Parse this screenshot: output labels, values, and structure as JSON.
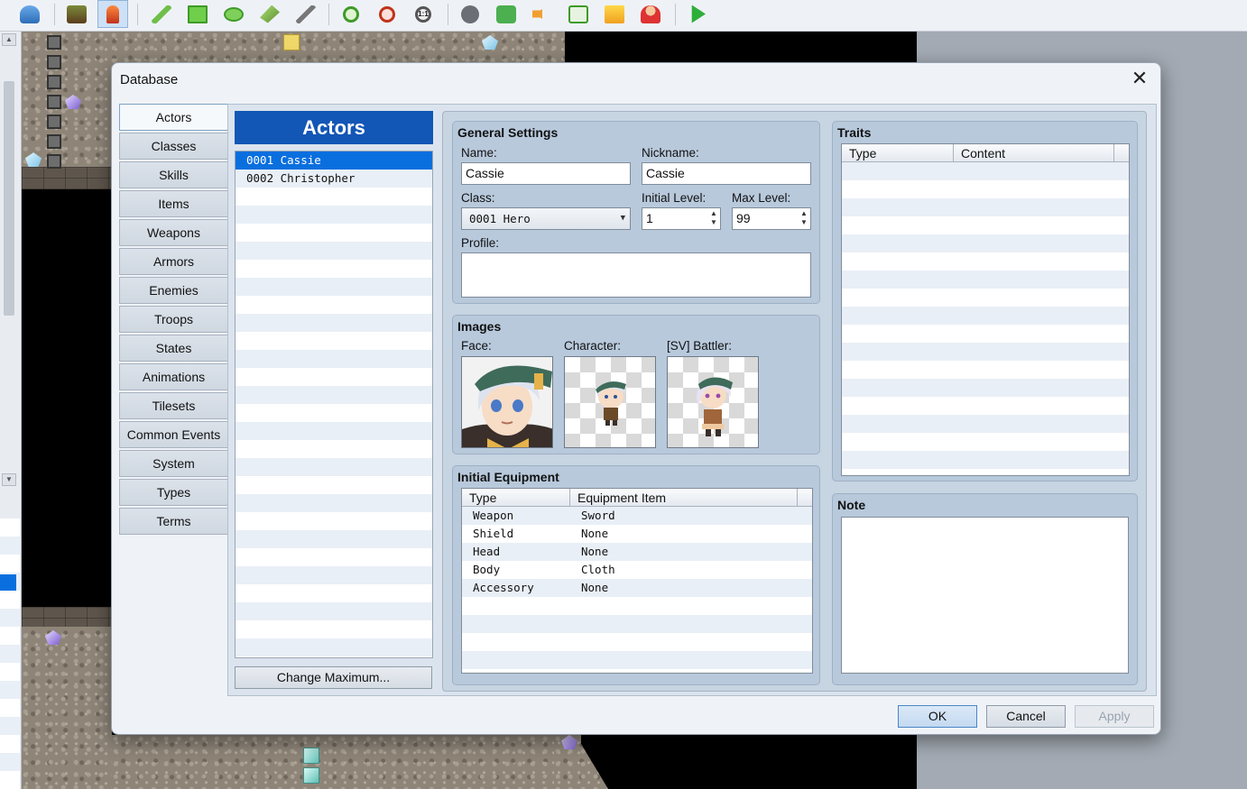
{
  "toolbar": {
    "icons": [
      "undo-icon",
      "map-layer-icon",
      "event-layer-icon",
      "pencil-icon",
      "rectangle-icon",
      "ellipse-icon",
      "flood-fill-icon",
      "shadow-pen-icon",
      "zoom-in-icon",
      "zoom-out-icon",
      "zoom-actual-icon",
      "database-icon",
      "plugin-manager-icon",
      "sound-test-icon",
      "event-searcher-icon",
      "resource-manager-icon",
      "character-generator-icon",
      "playtest-icon"
    ],
    "actual_size_label": "1:1"
  },
  "dialog": {
    "title": "Database",
    "close_glyph": "✕",
    "nav_items": [
      "Actors",
      "Classes",
      "Skills",
      "Items",
      "Weapons",
      "Armors",
      "Enemies",
      "Troops",
      "States",
      "Animations",
      "Tilesets",
      "Common Events",
      "System",
      "Types",
      "Terms"
    ],
    "selected_nav": "Actors",
    "ok_label": "OK",
    "cancel_label": "Cancel",
    "apply_label": "Apply"
  },
  "actors": {
    "header": "Actors",
    "list": [
      "0001 Cassie",
      "0002 Christopher"
    ],
    "selected_index": 0,
    "change_max_label": "Change Maximum..."
  },
  "general": {
    "title": "General Settings",
    "name_label": "Name:",
    "name_value": "Cassie",
    "nickname_label": "Nickname:",
    "nickname_value": "Cassie",
    "class_label": "Class:",
    "class_value": "0001 Hero",
    "initial_level_label": "Initial Level:",
    "initial_level_value": "1",
    "max_level_label": "Max Level:",
    "max_level_value": "99",
    "profile_label": "Profile:",
    "profile_value": ""
  },
  "images": {
    "title": "Images",
    "face_label": "Face:",
    "character_label": "Character:",
    "battler_label": "[SV] Battler:"
  },
  "equipment": {
    "title": "Initial Equipment",
    "columns": [
      "Type",
      "Equipment Item"
    ],
    "rows": [
      {
        "type": "Weapon",
        "item": "Sword"
      },
      {
        "type": "Shield",
        "item": "None"
      },
      {
        "type": "Head",
        "item": "None"
      },
      {
        "type": "Body",
        "item": "Cloth"
      },
      {
        "type": "Accessory",
        "item": "None"
      }
    ]
  },
  "traits": {
    "title": "Traits",
    "columns": [
      "Type",
      "Content"
    ]
  },
  "note": {
    "title": "Note",
    "value": ""
  },
  "colors": {
    "accent": "#1256b6",
    "selection": "#0a6fde"
  }
}
